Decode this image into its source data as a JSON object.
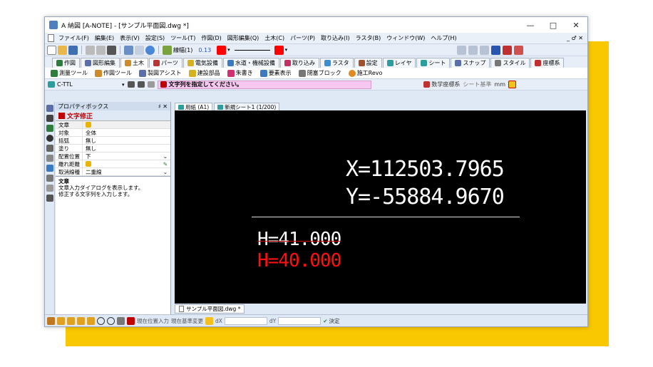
{
  "window": {
    "title": "A 納図 [A-NOTE] - [サンプル平面図.dwg *]",
    "minimize": "—",
    "maximize": "□",
    "close": "✕"
  },
  "menu": {
    "items": [
      "ファイル(F)",
      "編集(E)",
      "表示(V)",
      "設定(S)",
      "ツール(T)",
      "作図(D)",
      "図形編集(Q)",
      "土木(C)",
      "パーツ(P)",
      "取り込み(I)",
      "ラスタ(B)",
      "ウィンドウ(W)",
      "ヘルプ(H)"
    ],
    "mdi_controls": "_ ♂ ✕"
  },
  "toolbar1": {
    "line_label": "線幅(1)",
    "line_width": "0.13"
  },
  "tabs": [
    "作図",
    "図形編集",
    "土木",
    "パーツ",
    "電気設備",
    "水道・機械設備",
    "取り込み",
    "ラスタ",
    "設定",
    "レイヤ",
    "シート",
    "スナップ",
    "スタイル",
    "座標系"
  ],
  "active_tab": "土木",
  "subtools": [
    "測量ツール",
    "作図ツール",
    "製図アシスト",
    "建設部品",
    "朱書き",
    "要素表示",
    "閉塞ブロック",
    "施工Revo"
  ],
  "cmdbar": {
    "layer": "C-TTL",
    "prompt": "文字列を指定してください。",
    "coord_system": "数学座標系",
    "sheet_base": "シート基準",
    "unit": "mm"
  },
  "props": {
    "header": "プロパティボックス",
    "pin": "♯ ✕",
    "title": "文字修正",
    "rows": [
      {
        "k": "文章",
        "v": ""
      },
      {
        "k": "対象",
        "v": "全体"
      },
      {
        "k": "括弧",
        "v": "無し"
      },
      {
        "k": "塗り",
        "v": "無し"
      },
      {
        "k": "配置位置",
        "v": "下"
      },
      {
        "k": "離れ距離",
        "v": ""
      },
      {
        "k": "取消線種",
        "v": "二重線"
      }
    ],
    "desc_title": "文章",
    "desc_line1": "文章入力ダイアログを表示します。",
    "desc_line2": "修正する文字列を入力します。"
  },
  "canvas": {
    "tab1": "用紙 (A1)",
    "tab2": "新規シート1 (1/200)",
    "x_text": "X=112503.7965",
    "y_text": "Y=-55884.9670",
    "h1_text": "H=41.000",
    "h2_text": "H=40.000",
    "doc_tab": "サンプル平面図.dwg *"
  },
  "status": {
    "pos_input": "現在位置入力",
    "base_change": "現在基準変更",
    "dx_label": "dX",
    "dy_label": "dY",
    "confirm": "決定"
  },
  "colors": {
    "accent": "#f9c800",
    "canvas_bg": "#000000",
    "prompt_bg": "#f6c8f0",
    "h2_color": "#ff1010"
  }
}
